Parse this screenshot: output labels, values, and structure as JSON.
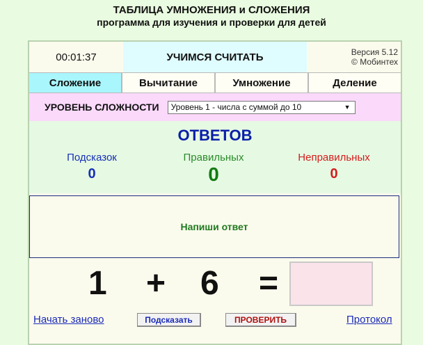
{
  "header": {
    "title": "ТАБЛИЦА УМНОЖЕНИЯ и СЛОЖЕНИЯ",
    "subtitle": "программа для изучения и проверки для детей"
  },
  "top": {
    "timer": "00:01:37",
    "mode_title": "УЧИМСЯ СЧИТАТЬ",
    "version": "Версия 5.12",
    "copyright": "© Мобинтех"
  },
  "tabs": [
    {
      "label": "Сложение",
      "active": true
    },
    {
      "label": "Вычитание",
      "active": false
    },
    {
      "label": "Умножение",
      "active": false
    },
    {
      "label": "Деление",
      "active": false
    }
  ],
  "level": {
    "label": "УРОВЕНЬ СЛОЖНОСТИ",
    "selected": "Уровень 1 - числа с суммой до 10"
  },
  "stats": {
    "answers_title": "ОТВЕТОВ",
    "hints_label": "Подсказок",
    "hints_value": "0",
    "correct_label": "Правильных",
    "correct_value": "0",
    "wrong_label": "Неправильных",
    "wrong_value": "0"
  },
  "message": "Напиши ответ",
  "equation": {
    "a": "1",
    "op": "+",
    "b": "6",
    "eq": "=",
    "answer": ""
  },
  "bottom": {
    "restart": "Начать заново",
    "hint_button": "Подсказать",
    "check_button": "ПРОВЕРИТЬ",
    "protocol": "Протокол"
  },
  "colors": {
    "background": "#e9fbe0",
    "active_tab": "#a9f6fd",
    "level_bar": "#fbd9fb",
    "answers_blue": "#0a1eaa",
    "correct_green": "#137b13",
    "wrong_red": "#d41c1c",
    "check_red": "#b01010"
  }
}
